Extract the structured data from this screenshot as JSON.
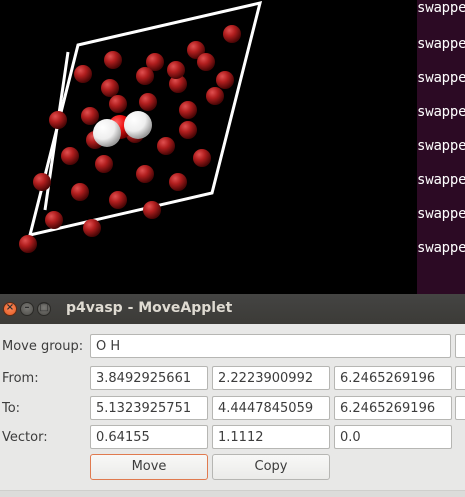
{
  "terminal": {
    "lines": [
      "swappe",
      "swappe",
      "swappe",
      "swappe",
      "swappe",
      "swappe",
      "swappe",
      "swappe"
    ]
  },
  "window": {
    "title": "p4vasp - MoveApplet",
    "close_glyph": "×",
    "minimize_glyph": "–",
    "maximize_glyph": "□"
  },
  "form": {
    "move_group_label": "Move group:",
    "move_group_value": "O H",
    "from_label": "From:",
    "from": [
      "3.8492925661",
      "2.2223900992",
      "6.2465269196"
    ],
    "to_label": "To:",
    "to": [
      "5.1323925751",
      "4.4447845059",
      "6.2465269196"
    ],
    "vector_label": "Vector:",
    "vector": [
      "0.64155",
      "1.1112",
      "0.0"
    ],
    "move_button": "Move",
    "copy_button": "Copy"
  },
  "colors": {
    "atom_red": "#b01e1e",
    "selected_oxygen": "#ee1111",
    "hydrogen": "#ffffff",
    "cell_lines": "#ffffff",
    "terminal_bg": "#2c0a24",
    "focus_border": "#e07a4f"
  },
  "icons": {
    "close": "close-icon",
    "minimize": "minimize-icon",
    "maximize": "maximize-icon"
  }
}
